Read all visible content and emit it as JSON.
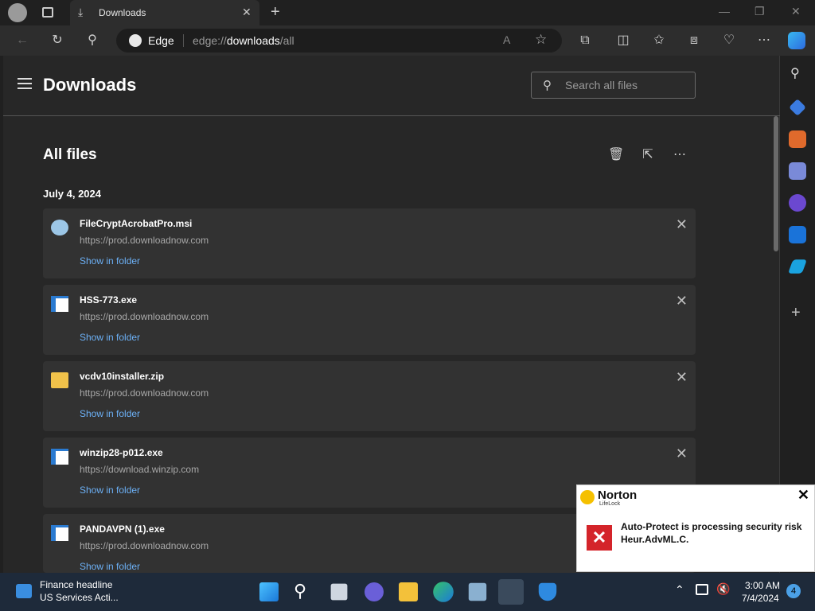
{
  "browser": {
    "tab_title": "Downloads",
    "address_identity": "Edge",
    "address_prefix": "edge://",
    "address_host": "downloads",
    "address_path": "/all"
  },
  "page": {
    "title": "Downloads",
    "search_placeholder": "Search all files",
    "section_title": "All files",
    "date_group": "July 4, 2024"
  },
  "downloads": [
    {
      "name": "FileCryptAcrobatPro.msi",
      "url": "https://prod.downloadnow.com",
      "action": "Show in folder",
      "icon": "installer-icon"
    },
    {
      "name": "HSS-773.exe",
      "url": "https://prod.downloadnow.com",
      "action": "Show in folder",
      "icon": "exe-icon"
    },
    {
      "name": "vcdv10installer.zip",
      "url": "https://prod.downloadnow.com",
      "action": "Show in folder",
      "icon": "zip-folder-icon"
    },
    {
      "name": "winzip28-p012.exe",
      "url": "https://download.winzip.com",
      "action": "Show in folder",
      "icon": "exe-icon"
    },
    {
      "name": "PANDAVPN (1).exe",
      "url": "https://prod.downloadnow.com",
      "action": "Show in folder",
      "icon": "exe-icon"
    }
  ],
  "norton": {
    "brand": "Norton",
    "sub_brand": "LifeLock",
    "message_line1": "Auto-Protect is processing security risk",
    "message_line2": "Heur.AdvML.C."
  },
  "taskbar": {
    "news_title": "Finance headline",
    "news_sub": "US Services Acti...",
    "time": "3:00 AM",
    "date": "7/4/2024",
    "notifications": "4"
  },
  "colors": {
    "link": "#6cb0f5",
    "alert_red": "#d4242a",
    "norton_yellow": "#f5c000"
  }
}
